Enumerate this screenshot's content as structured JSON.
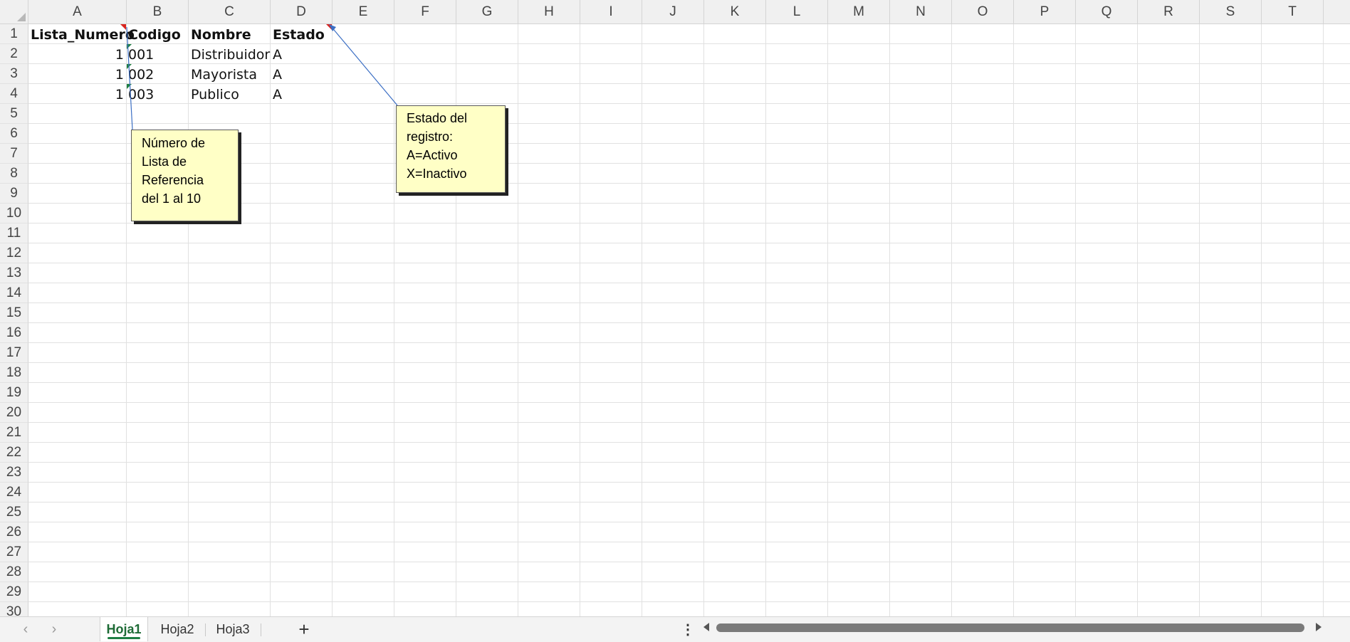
{
  "columns": [
    "A",
    "B",
    "C",
    "D",
    "E",
    "F",
    "G",
    "H",
    "I",
    "J",
    "K",
    "L",
    "M",
    "N",
    "O",
    "P",
    "Q",
    "R",
    "S",
    "T"
  ],
  "rows": [
    "1",
    "2",
    "3",
    "4",
    "5",
    "6",
    "7",
    "8",
    "9",
    "10",
    "11",
    "12",
    "13",
    "14",
    "15",
    "16",
    "17",
    "18",
    "19",
    "20",
    "21",
    "22",
    "23",
    "24",
    "25",
    "26",
    "27",
    "28",
    "29",
    "30"
  ],
  "cells": {
    "A1": "Lista_Numero",
    "B1": "Codigo",
    "C1": "Nombre",
    "D1": "Estado",
    "A2": "1",
    "B2": "001",
    "C2": "Distribuidor",
    "D2": "A",
    "A3": "1",
    "B3": "002",
    "C3": "Mayorista",
    "D3": "A",
    "A4": "1",
    "B4": "003",
    "C4": "Publico",
    "D4": "A"
  },
  "comments": {
    "lista": [
      "Número de",
      "Lista de",
      "Referencia",
      "del 1 al 10"
    ],
    "estado": [
      "Estado del",
      "registro:",
      "A=Activo",
      "X=Inactivo"
    ]
  },
  "sheet_tabs": {
    "tab1": "Hoja1",
    "tab2": "Hoja2",
    "tab3": "Hoja3",
    "active": "Hoja1"
  },
  "tabbar": {
    "add_icon": "plus-icon",
    "add_glyph": "+",
    "nav_prev_glyph": "‹",
    "nav_next_glyph": "›",
    "more_glyph": "⋮"
  },
  "colors": {
    "comment_bg": "#ffffc6",
    "comment_indicator": "#d9241f",
    "error_indicator": "#1e7f43",
    "active_tab_text": "#1e6b36",
    "leader_line": "#3c6fc4"
  }
}
